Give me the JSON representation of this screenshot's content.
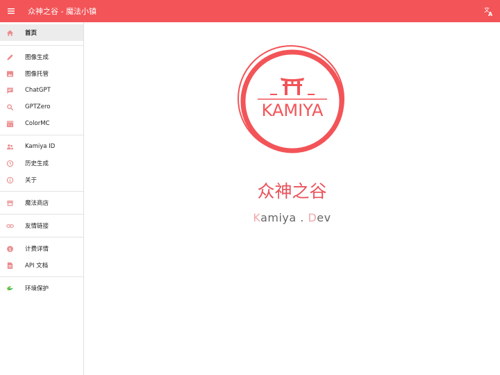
{
  "header": {
    "title": "众神之谷 - 魔法小镇",
    "menu_icon": "menu-icon",
    "translate_icon": "translate-icon",
    "color": "#f25458"
  },
  "sidebar": {
    "items": [
      {
        "label": "首页",
        "icon": "home-icon"
      },
      {
        "label": "图像生成",
        "icon": "pencil-icon"
      },
      {
        "label": "图像托管",
        "icon": "image-icon"
      },
      {
        "label": "ChatGPT",
        "icon": "chat-icon"
      },
      {
        "label": "GPTZero",
        "icon": "search-icon"
      },
      {
        "label": "ColorMC",
        "icon": "grass-block-icon"
      },
      {
        "label": "Kamiya ID",
        "icon": "people-icon"
      },
      {
        "label": "历史生成",
        "icon": "clock-icon"
      },
      {
        "label": "关于",
        "icon": "info-icon"
      },
      {
        "label": "魔法商店",
        "icon": "store-icon"
      },
      {
        "label": "友情链接",
        "icon": "link-icon"
      },
      {
        "label": "计费详情",
        "icon": "dollar-icon"
      },
      {
        "label": "API 文档",
        "icon": "document-icon"
      },
      {
        "label": "环境保护",
        "icon": "leaf-icon"
      }
    ]
  },
  "main": {
    "logo_text": "KAMIYA",
    "title": "众神之谷",
    "subtitle_k": "K",
    "subtitle_1": "amiya . ",
    "subtitle_d": "D",
    "subtitle_2": "ev"
  },
  "colors": {
    "accent": "#f25458",
    "accent_light": "#f0a8ab",
    "icon": "#ea8c8f"
  }
}
